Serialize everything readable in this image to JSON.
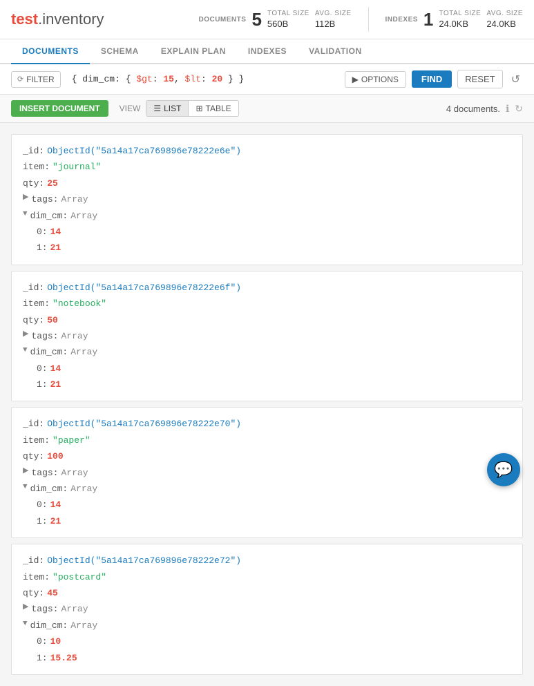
{
  "logo": {
    "test": "test",
    "dot": ".",
    "inventory": "inventory"
  },
  "documents_stat": {
    "label": "DOCUMENTS",
    "count": "5",
    "total_size_label": "TOTAL SIZE",
    "total_size": "560B",
    "avg_size_label": "AVG. SIZE",
    "avg_size": "112B"
  },
  "indexes_stat": {
    "label": "INDEXES",
    "count": "1",
    "total_size_label": "TOTAL SIZE",
    "total_size": "24.0KB",
    "avg_size_label": "AVG. SIZE",
    "avg_size": "24.0KB"
  },
  "tabs": [
    {
      "label": "DOCUMENTS",
      "active": true
    },
    {
      "label": "SCHEMA",
      "active": false
    },
    {
      "label": "EXPLAIN PLAN",
      "active": false
    },
    {
      "label": "INDEXES",
      "active": false
    },
    {
      "label": "VALIDATION",
      "active": false
    }
  ],
  "filter": {
    "button_label": "FILTER",
    "query": "{ dim_cm: { $gt: 15, $lt: 20 } }",
    "options_label": "OPTIONS"
  },
  "toolbar": {
    "find_label": "FIND",
    "reset_label": "RESET"
  },
  "actions": {
    "insert_label": "INSERT DOCUMENT",
    "view_label": "VIEW",
    "list_label": "LIST",
    "table_label": "TABLE",
    "doc_count": "4 documents."
  },
  "documents": [
    {
      "id": "5a14a17ca769896e78222e6e",
      "item": "journal",
      "qty": 25,
      "tags": "Array",
      "dim_cm": "Array",
      "dim_cm_0": 14,
      "dim_cm_1": 21
    },
    {
      "id": "5a14a17ca769896e78222e6f",
      "item": "notebook",
      "qty": 50,
      "tags": "Array",
      "dim_cm": "Array",
      "dim_cm_0": 14,
      "dim_cm_1": 21
    },
    {
      "id": "5a14a17ca769896e78222e70",
      "item": "paper",
      "qty": 100,
      "tags": "Array",
      "dim_cm": "Array",
      "dim_cm_0": 14,
      "dim_cm_1": 21
    },
    {
      "id": "5a14a17ca769896e78222e72",
      "item": "postcard",
      "qty": 45,
      "tags": "Array",
      "dim_cm": "Array",
      "dim_cm_0": 10,
      "dim_cm_1_str": "15.25"
    }
  ]
}
